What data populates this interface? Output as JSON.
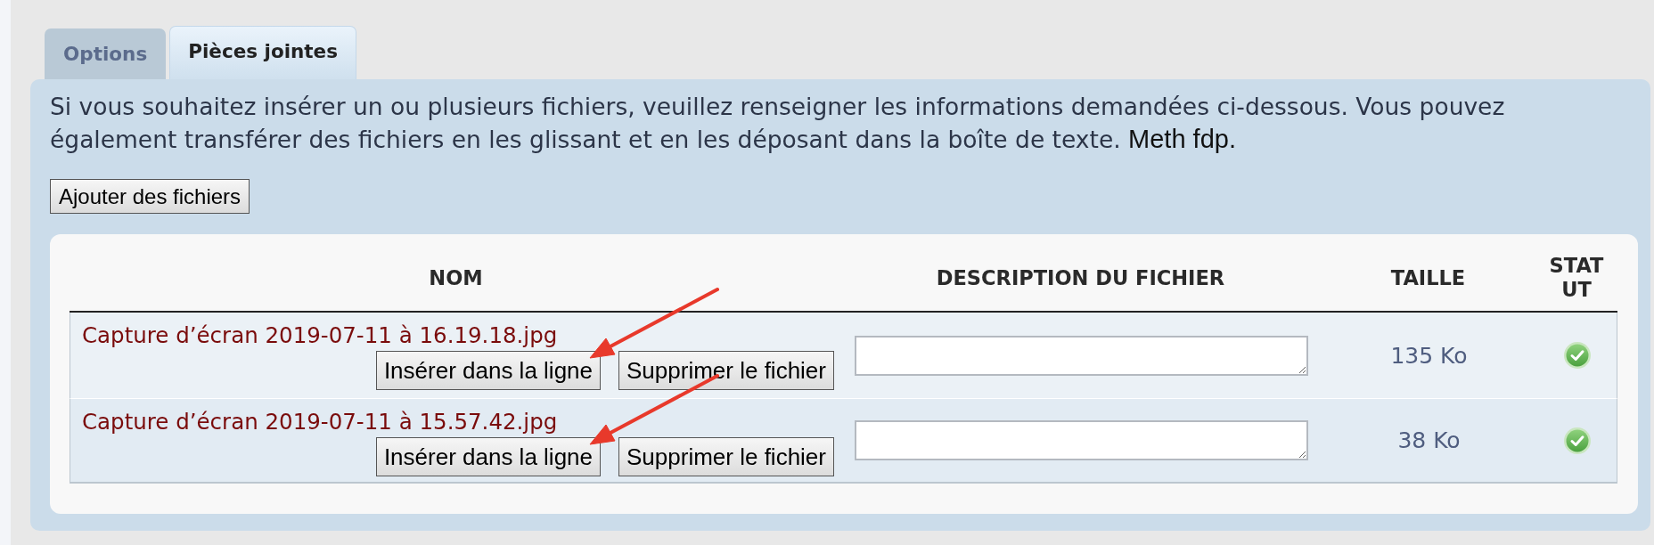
{
  "tabs": [
    {
      "label": "Options",
      "selected": false
    },
    {
      "label": "Pièces jointes",
      "selected": true
    }
  ],
  "panel": {
    "intro": "Si vous souhaitez insérer un ou plusieurs fichiers, veuillez renseigner les informations demandées ci-dessous. Vous pouvez également transférer des fichiers en les glissant et en les déposant dans la boîte de texte.",
    "note": "Meth fdp.",
    "add_button": "Ajouter des fichiers"
  },
  "table": {
    "columns": [
      "NOM",
      "DESCRIPTION DU FICHIER",
      "TAILLE",
      "STATUT"
    ],
    "rows": [
      {
        "file_name": "Capture d’écran 2019-07-11 à 16.19.18.jpg",
        "actions": [
          "Insérer dans la ligne",
          "Supprimer le fichier"
        ],
        "size": "135 Ko",
        "uploaded": true
      },
      {
        "file_name": "Capture d’écran 2019-07-11 à 15.57.42.jpg",
        "actions": [
          "Insérer dans la ligne",
          "Supprimer le fichier"
        ],
        "size": "38 Ko",
        "uploaded": true
      }
    ]
  }
}
